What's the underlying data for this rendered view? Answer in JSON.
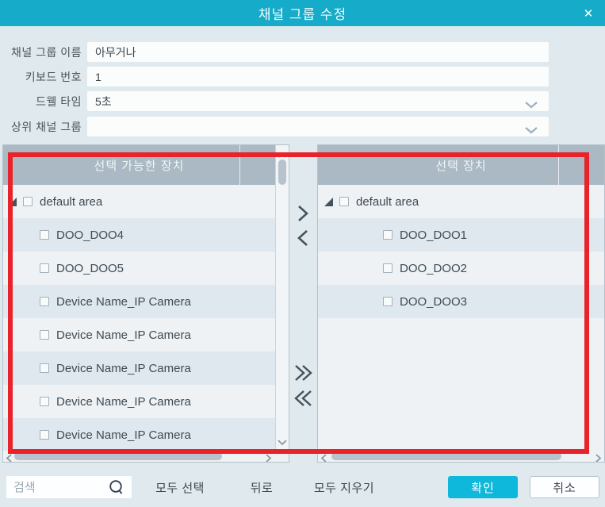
{
  "titlebar": {
    "title": "채널 그룹 수정",
    "close_icon": "✕"
  },
  "form": {
    "fields": [
      {
        "label": "채널 그룹 이름",
        "value": "아무거나",
        "type": "text"
      },
      {
        "label": "키보드 번호",
        "value": "1",
        "type": "text"
      },
      {
        "label": "드웰 타임",
        "value": "5초",
        "type": "select"
      },
      {
        "label": "상위 채널 그룹",
        "value": "",
        "type": "select"
      }
    ]
  },
  "panels": {
    "left": {
      "header": "선택 가능한 장치",
      "items": [
        {
          "label": "default area",
          "level": 0,
          "expanded": true
        },
        {
          "label": "DOO_DOO4",
          "level": 1
        },
        {
          "label": "DOO_DOO5",
          "level": 1
        },
        {
          "label": "Device Name_IP Camera",
          "level": 1
        },
        {
          "label": "Device Name_IP Camera",
          "level": 1
        },
        {
          "label": "Device Name_IP Camera",
          "level": 1
        },
        {
          "label": "Device Name_IP Camera",
          "level": 1
        },
        {
          "label": "Device Name_IP Camera",
          "level": 1
        }
      ]
    },
    "right": {
      "header": "선택 장치",
      "items": [
        {
          "label": "default area",
          "level": 0,
          "expanded": true
        },
        {
          "label": "DOO_DOO1",
          "level": 1
        },
        {
          "label": "DOO_DOO2",
          "level": 1
        },
        {
          "label": "DOO_DOO3",
          "level": 1
        }
      ]
    }
  },
  "footer": {
    "search_placeholder": "검색",
    "select_all_label": "모두 선택",
    "back_label": "뒤로",
    "clear_all_label": "모두 지우기",
    "ok_label": "확인",
    "cancel_label": "취소"
  },
  "colors": {
    "titlebar": "#16abc8",
    "ok_button": "#0eb8db",
    "panel_header": "#aab9c4",
    "row_alt": "#dfe8ef",
    "highlight_border": "#e8232a"
  }
}
